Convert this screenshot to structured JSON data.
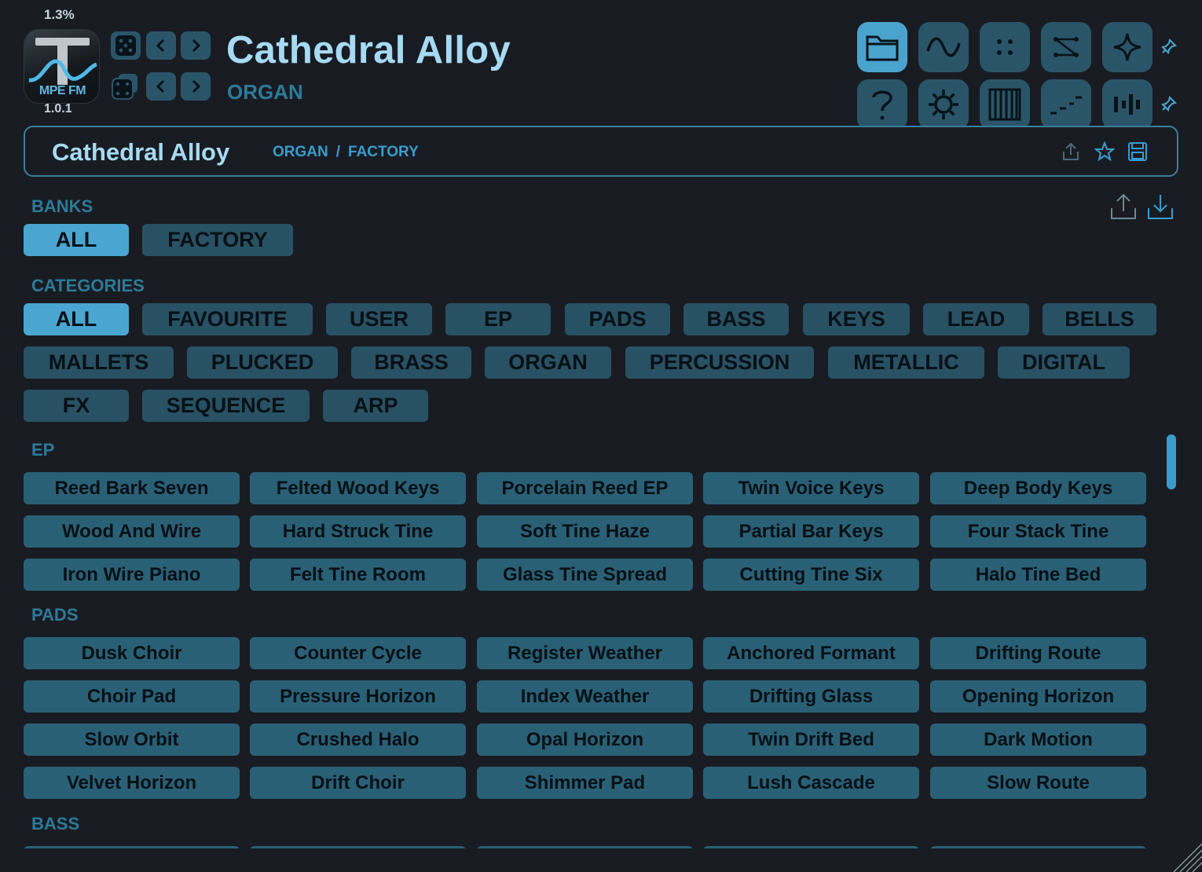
{
  "header": {
    "cpu": "1.3%",
    "logo_text": "MPE FM",
    "version": "1.0.1",
    "patch_name": "Cathedral Alloy",
    "patch_category": "ORGAN"
  },
  "icons": {
    "random": "dice-icon",
    "random_multi": "dice-stack-icon",
    "prev": "chevron-left-icon",
    "next": "chevron-right-icon",
    "toolbar_top": [
      "folder-icon",
      "wave-icon",
      "dots-icon",
      "shuffle-icon",
      "sparkle-icon"
    ],
    "toolbar_bottom": [
      "help-icon",
      "gear-icon",
      "keyboard-icon",
      "steps-icon",
      "bars-icon"
    ]
  },
  "patch_bar": {
    "name": "Cathedral Alloy",
    "category": "ORGAN",
    "separator": "/",
    "bank": "FACTORY"
  },
  "banks": {
    "label": "BANKS",
    "items": [
      "ALL",
      "FACTORY"
    ],
    "selected": "ALL"
  },
  "categories": {
    "label": "CATEGORIES",
    "items": [
      "ALL",
      "FAVOURITE",
      "USER",
      "EP",
      "PADS",
      "BASS",
      "KEYS",
      "LEAD",
      "BELLS",
      "MALLETS",
      "PLUCKED",
      "BRASS",
      "ORGAN",
      "PERCUSSION",
      "METALLIC",
      "DIGITAL",
      "FX",
      "SEQUENCE",
      "ARP"
    ],
    "selected": "ALL"
  },
  "groups": [
    {
      "label": "EP",
      "presets": [
        "Reed Bark Seven",
        "Felted Wood Keys",
        "Porcelain Reed EP",
        "Twin Voice Keys",
        "Deep Body Keys",
        "Wood And Wire",
        "Hard Struck Tine",
        "Soft Tine Haze",
        "Partial Bar Keys",
        "Four Stack Tine",
        "Iron Wire Piano",
        "Felt Tine Room",
        "Glass Tine Spread",
        "Cutting Tine Six",
        "Halo Tine Bed"
      ]
    },
    {
      "label": "PADS",
      "presets": [
        "Dusk Choir",
        "Counter Cycle",
        "Register Weather",
        "Anchored Formant",
        "Drifting Route",
        "Choir Pad",
        "Pressure Horizon",
        "Index Weather",
        "Drifting Glass",
        "Opening Horizon",
        "Slow Orbit",
        "Crushed Halo",
        "Opal Horizon",
        "Twin Drift Bed",
        "Dark Motion",
        "Velvet Horizon",
        "Drift Choir",
        "Shimmer Pad",
        "Lush Cascade",
        "Slow Route"
      ]
    },
    {
      "label": "BASS",
      "presets": [
        "",
        "",
        "",
        "",
        ""
      ]
    }
  ],
  "colors": {
    "background": "#181c22",
    "chip": "#285163",
    "chip_active": "#4aa6d0",
    "preset": "#2a6075",
    "label": "#2d7a99",
    "title": "#a6daf2"
  }
}
